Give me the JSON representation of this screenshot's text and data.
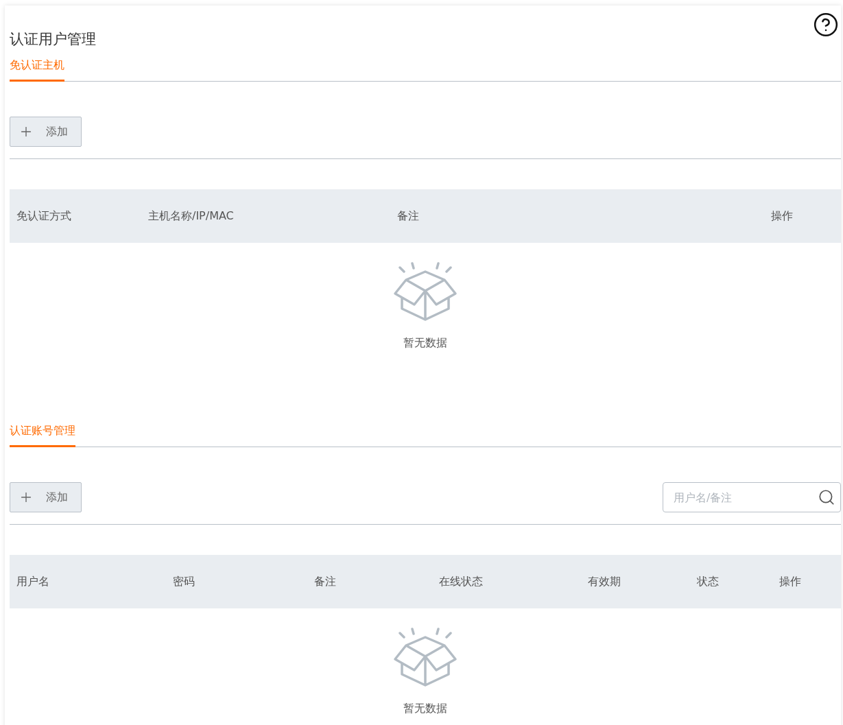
{
  "page": {
    "title": "认证用户管理"
  },
  "sections": [
    {
      "tab": {
        "label": "免认证主机",
        "selected": true
      },
      "add_button": {
        "label": "添加"
      },
      "table": {
        "columns": [
          {
            "label": "免认证方式"
          },
          {
            "label": "主机名称/IP/MAC"
          },
          {
            "label": "备注"
          },
          {
            "label": "操作"
          }
        ],
        "empty_text": "暂无数据"
      }
    },
    {
      "tab": {
        "label": "认证账号管理",
        "selected": true
      },
      "add_button": {
        "label": "添加"
      },
      "search": {
        "placeholder": "用户名/备注"
      },
      "table": {
        "columns": [
          {
            "label": "用户名"
          },
          {
            "label": "密码"
          },
          {
            "label": "备注"
          },
          {
            "label": "在线状态"
          },
          {
            "label": "有效期"
          },
          {
            "label": "状态"
          },
          {
            "label": "操作"
          }
        ],
        "empty_text": "暂无数据"
      }
    }
  ]
}
